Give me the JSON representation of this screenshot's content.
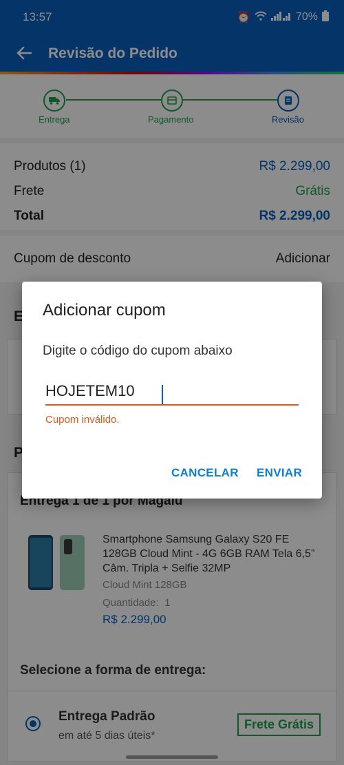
{
  "status": {
    "time": "13:57",
    "battery": "70%"
  },
  "appbar": {
    "title": "Revisão do Pedido"
  },
  "stepper": {
    "steps": [
      {
        "label": "Entrega"
      },
      {
        "label": "Pagamento"
      },
      {
        "label": "Revisão"
      }
    ]
  },
  "summary": {
    "products_label": "Produtos (1)",
    "products_value": "R$ 2.299,00",
    "shipping_label": "Frete",
    "shipping_value": "Grátis",
    "total_label": "Total",
    "total_value": "R$ 2.299,00"
  },
  "coupon": {
    "label": "Cupom de desconto",
    "action": "Adicionar"
  },
  "background_partial": {
    "section_initial_1": "E",
    "section_initial_2": "P"
  },
  "delivery": {
    "header": "Entrega 1 de 1 por Magalu",
    "product": {
      "name": "Smartphone Samsung Galaxy S20 FE 128GB Cloud Mint - 4G 6GB RAM Tela 6,5” Câm. Tripla + Selfie 32MP",
      "variant": "Cloud Mint 128GB",
      "quantity": "Quantidade:  1",
      "price": "R$ 2.299,00"
    },
    "shipping_select_title": "Selecione a forma de entrega:",
    "option_name": "Entrega Padrão",
    "option_eta": "em até 5 dias úteis*",
    "option_badge": "Frete Grátis"
  },
  "dialog": {
    "title": "Adicionar cupom",
    "subtitle": "Digite o código do cupom abaixo",
    "input_value": "HOJETEM10",
    "error": "Cupom inválido.",
    "cancel": "CANCELAR",
    "submit": "ENVIAR"
  },
  "colors": {
    "primary": "#0a5fc0",
    "success": "#1aa34a",
    "error": "#e0561b"
  }
}
